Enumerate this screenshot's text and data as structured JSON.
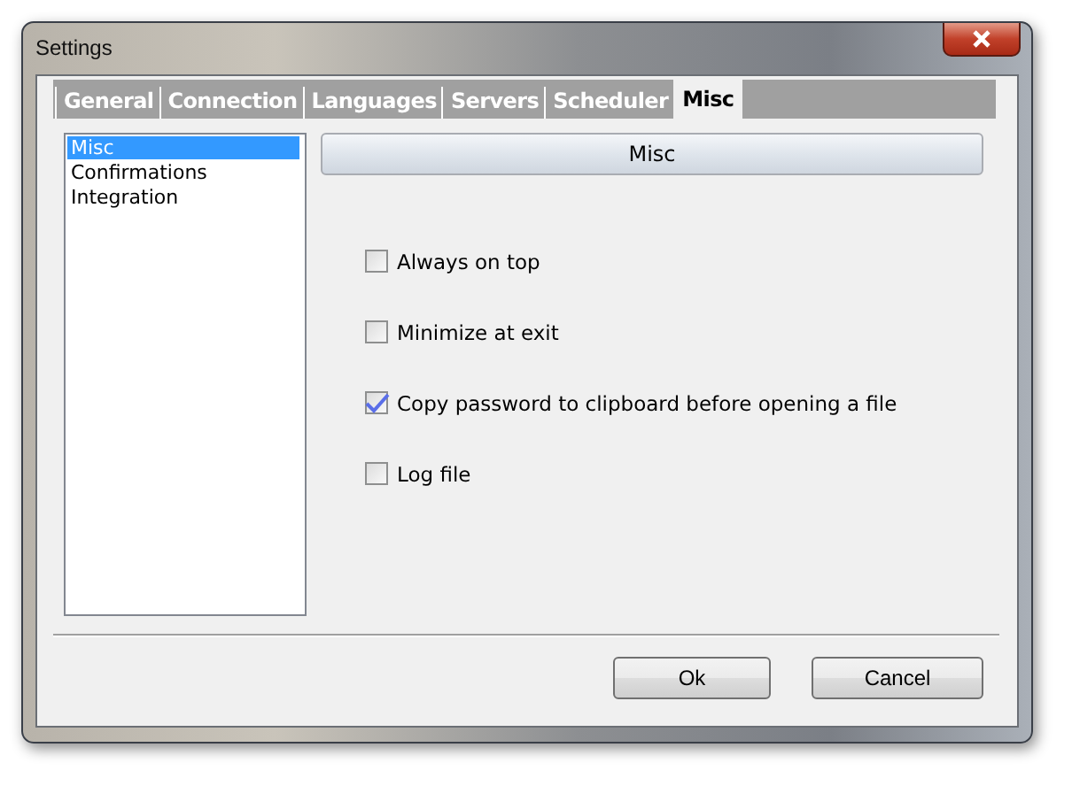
{
  "window": {
    "title": "Settings"
  },
  "tabs": [
    {
      "label": "General",
      "selected": false
    },
    {
      "label": "Connection",
      "selected": false
    },
    {
      "label": "Languages",
      "selected": false
    },
    {
      "label": "Servers",
      "selected": false
    },
    {
      "label": "Scheduler",
      "selected": false
    },
    {
      "label": "Misc",
      "selected": true
    }
  ],
  "sidebar": {
    "items": [
      {
        "label": "Misc",
        "selected": true
      },
      {
        "label": "Confirmations",
        "selected": false
      },
      {
        "label": "Integration",
        "selected": false
      }
    ]
  },
  "section_header": "Misc",
  "options": [
    {
      "label": "Always on top",
      "checked": false
    },
    {
      "label": "Minimize at exit",
      "checked": false
    },
    {
      "label": "Copy password to clipboard before opening a file",
      "checked": true
    },
    {
      "label": "Log file",
      "checked": false
    }
  ],
  "buttons": [
    "Ok",
    "Cancel"
  ]
}
